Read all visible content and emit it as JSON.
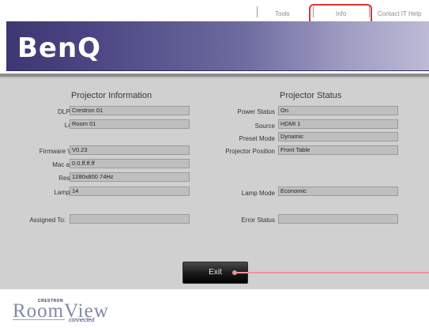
{
  "nav": {
    "tools": "Tools",
    "info": "Info",
    "contact": "Contact IT Help"
  },
  "brand": {
    "logo": "BenQ"
  },
  "projector_information": {
    "title": "Projector Information",
    "fields": [
      {
        "label": "DLP Name",
        "value": "Crestron 01"
      },
      {
        "label": "Location",
        "value": "Room 01"
      },
      {
        "label": "Firmware Version",
        "value": "V0.23"
      },
      {
        "label": "Mac address",
        "value": "0.0.ff.ff.ff"
      },
      {
        "label": "Resolution",
        "value": "1280x800 74Hz"
      },
      {
        "label": "Lamp Hours",
        "value": "14"
      },
      {
        "label": "Assigned To:",
        "value": ""
      }
    ]
  },
  "projector_status": {
    "title": "Projector Status",
    "fields": [
      {
        "label": "Power Status",
        "value": "On"
      },
      {
        "label": "Source",
        "value": "HDMI 1"
      },
      {
        "label": "Preset Mode",
        "value": "Dynamic"
      },
      {
        "label": "Projector Position",
        "value": "Front Table"
      },
      {
        "label": "Lamp Mode",
        "value": "Economic"
      },
      {
        "label": "Error Status",
        "value": ""
      }
    ]
  },
  "actions": {
    "exit": "Exit"
  },
  "footer": {
    "crestron": "CRESTRON",
    "roomview": "RoomView",
    "connected": "connected"
  },
  "colors": {
    "highlight": "#e53030",
    "pointer": "#f2909a",
    "banner_start": "#3c3772"
  }
}
